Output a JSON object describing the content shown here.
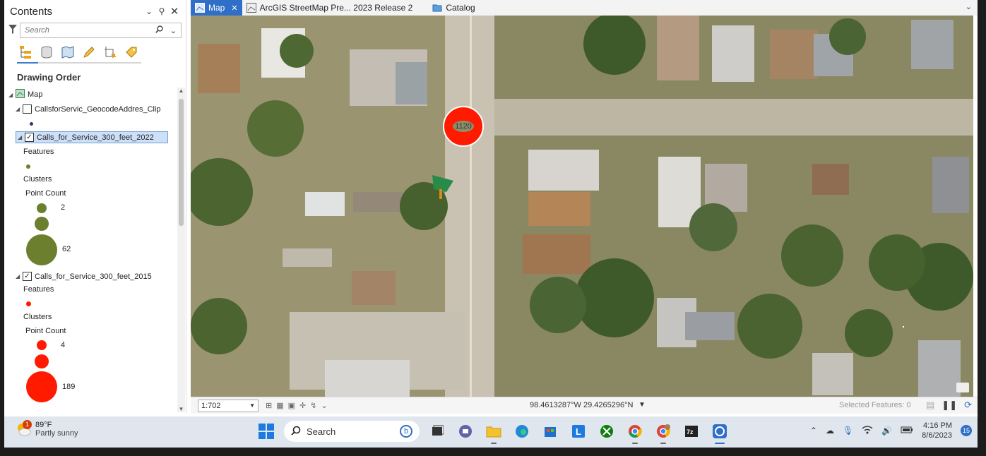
{
  "contents_pane": {
    "title": "Contents",
    "search_placeholder": "Search",
    "section_title": "Drawing Order",
    "map_label": "Map",
    "layers": [
      {
        "name": "CallsforServic_GeocodeAddres_Clip",
        "checked": false,
        "selected": false
      },
      {
        "name": "Calls_for_Service_300_feet_2022",
        "checked": true,
        "selected": true,
        "features_label": "Features",
        "clusters_label": "Clusters",
        "point_count_label": "Point Count",
        "count_min": "2",
        "count_max": "62",
        "color": "#6b7f2f"
      },
      {
        "name": "Calls_for_Service_300_feet_2015",
        "checked": true,
        "selected": false,
        "features_label": "Features",
        "clusters_label": "Clusters",
        "point_count_label": "Point Count",
        "count_min": "4",
        "count_max": "189",
        "color": "#ff1a00"
      }
    ]
  },
  "tabs": [
    {
      "label": "Map",
      "active": true,
      "icon": "map-icon"
    },
    {
      "label": "ArcGIS StreetMap Pre... 2023 Release 2",
      "active": false,
      "icon": "map-icon"
    },
    {
      "label": "Catalog",
      "active": false,
      "icon": "folder-icon"
    }
  ],
  "map": {
    "cluster_label": "1120",
    "cluster_color": "#ff1a00"
  },
  "statusbar": {
    "scale": "1:702",
    "coordinates": "98.4613287°W 29.4265296°N",
    "selected_features": "Selected Features: 0"
  },
  "taskbar": {
    "weather_temp": "89°F",
    "weather_desc": "Partly sunny",
    "weather_badge": "1",
    "search_label": "Search",
    "time": "4:16 PM",
    "date": "8/6/2023",
    "notification_count": "15"
  }
}
